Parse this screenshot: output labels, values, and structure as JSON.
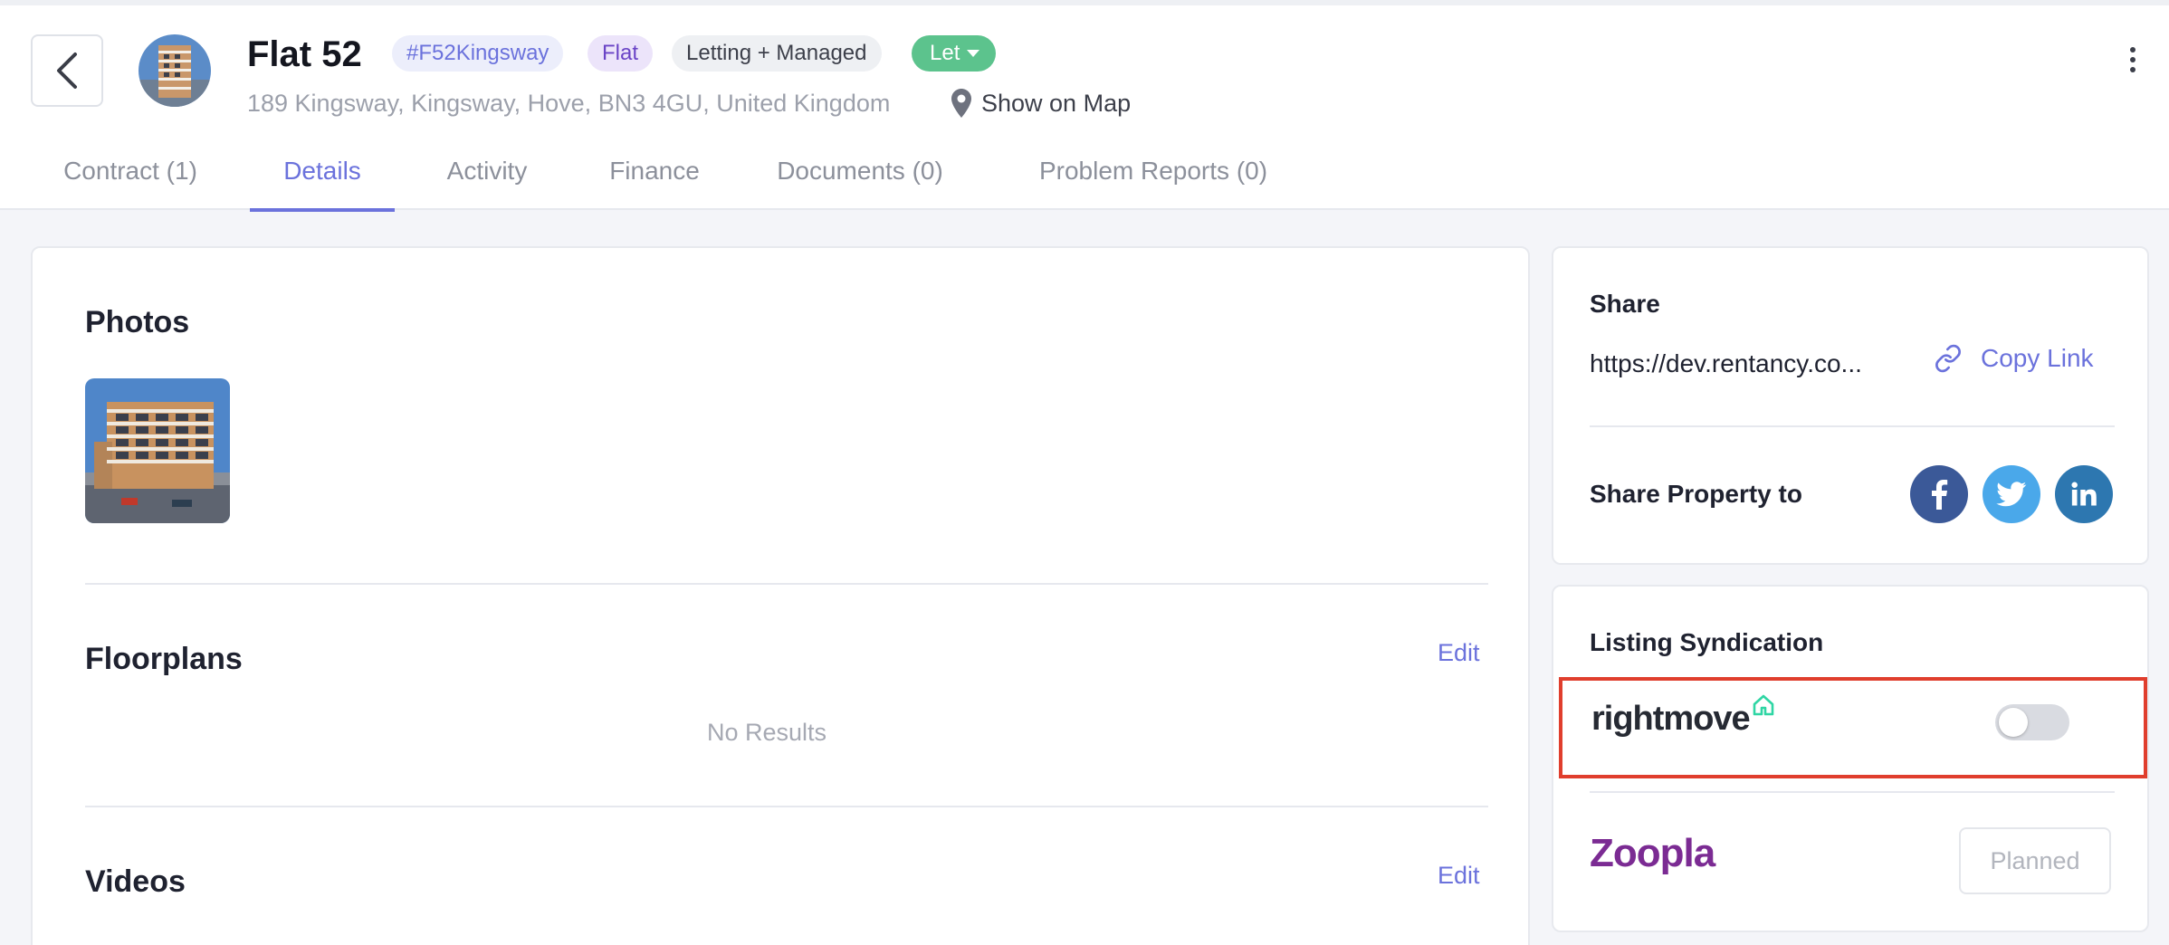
{
  "header": {
    "title": "Flat 52",
    "badges": {
      "reference": "#F52Kingsway",
      "type": "Flat",
      "management": "Letting + Managed",
      "status": "Let"
    },
    "address": "189 Kingsway, Kingsway, Hove, BN3 4GU, United Kingdom",
    "map_link": "Show on Map"
  },
  "tabs": [
    {
      "label": "Contract (1)",
      "active": false
    },
    {
      "label": "Details",
      "active": true
    },
    {
      "label": "Activity",
      "active": false
    },
    {
      "label": "Finance",
      "active": false
    },
    {
      "label": "Documents (0)",
      "active": false
    },
    {
      "label": "Problem Reports (0)",
      "active": false
    }
  ],
  "main": {
    "photos": {
      "title": "Photos"
    },
    "floorplans": {
      "title": "Floorplans",
      "edit_label": "Edit",
      "empty_text": "No Results"
    },
    "videos": {
      "title": "Videos",
      "edit_label": "Edit"
    }
  },
  "share": {
    "title": "Share",
    "url": "https://dev.rentancy.co...",
    "copy_label": "Copy Link",
    "share_to_label": "Share Property to",
    "networks": [
      "facebook",
      "twitter",
      "linkedin"
    ]
  },
  "syndication": {
    "title": "Listing Syndication",
    "rightmove": {
      "logo_text": "rightmove",
      "enabled": false
    },
    "zoopla": {
      "logo_text": "Zoopla",
      "status_label": "Planned"
    }
  },
  "colors": {
    "accent": "#6b72dc",
    "status_green": "#5cc38d",
    "highlight_red": "#e03e2d",
    "zoopla_purple": "#7b2b93",
    "rightmove_green": "#2fd6a4"
  }
}
